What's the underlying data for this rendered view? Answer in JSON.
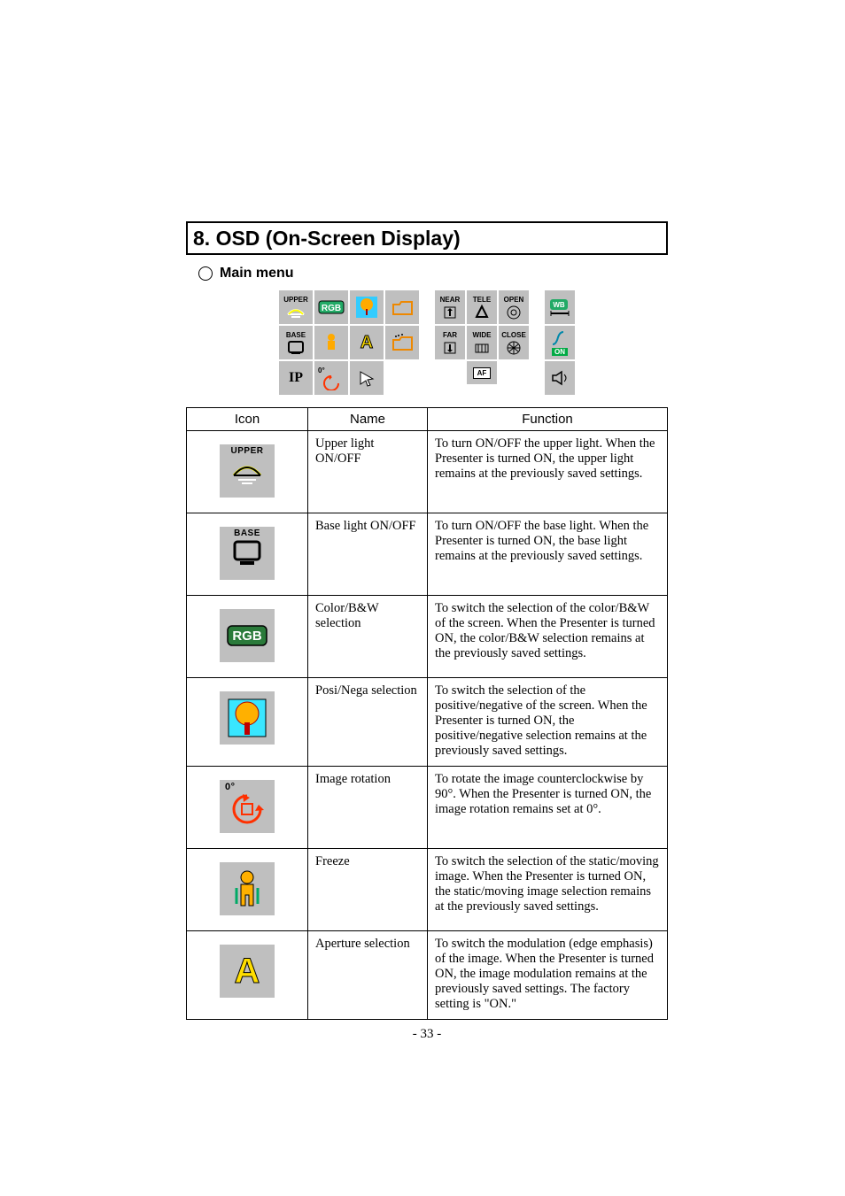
{
  "title": "8. OSD (On-Screen Display)",
  "subhead": "Main menu",
  "headers": {
    "icon": "Icon",
    "name": "Name",
    "function": "Function"
  },
  "rows": [
    {
      "icon_label": "UPPER",
      "name": "Upper light ON/OFF",
      "func": "To turn ON/OFF the upper light.\nWhen the Presenter is turned ON, the upper light remains at the previously saved settings."
    },
    {
      "icon_label": "BASE",
      "name": "Base light ON/OFF",
      "func": "To turn ON/OFF the base light.\nWhen the Presenter is turned ON, the base light remains at the previously saved settings."
    },
    {
      "icon_label": "",
      "name": "Color/B&W selection",
      "func": "To switch the selection of the color/B&W of the screen. When the Presenter is turned ON, the color/B&W selection remains at the previously saved settings."
    },
    {
      "icon_label": "",
      "name": "Posi/Nega selection",
      "func": "To switch the selection of the positive/negative of the screen. When the Presenter is turned ON, the positive/negative selection remains at the previously saved settings."
    },
    {
      "icon_label": "",
      "name": "Image rotation",
      "func": "To rotate the image counterclockwise by 90°.\nWhen the Presenter is turned ON, the image rotation remains set at 0°."
    },
    {
      "icon_label": "",
      "name": "Freeze",
      "func": "To switch the selection of the static/moving image. When the Presenter is turned ON, the static/moving image selection remains at the previously saved settings."
    },
    {
      "icon_label": "",
      "name": "Aperture selection",
      "func": "To switch the modulation (edge emphasis) of the image. When the Presenter is turned ON, the image modulation remains at the previously saved settings. The factory setting is \"ON.\""
    }
  ],
  "osd": {
    "g1": {
      "r1": [
        "UPPER",
        "",
        "",
        ""
      ],
      "r2": [
        "BASE",
        "",
        "",
        ""
      ],
      "r3": [
        "IP",
        "",
        ""
      ]
    },
    "g2": {
      "r1_labels": [
        "NEAR",
        "TELE",
        "OPEN"
      ],
      "r2_labels": [
        "FAR",
        "WIDE",
        "CLOSE"
      ],
      "r3_labels": [
        "AF"
      ]
    },
    "g3": {
      "r1": "WB",
      "r2": "ON"
    }
  },
  "page_number": "- 33 -"
}
